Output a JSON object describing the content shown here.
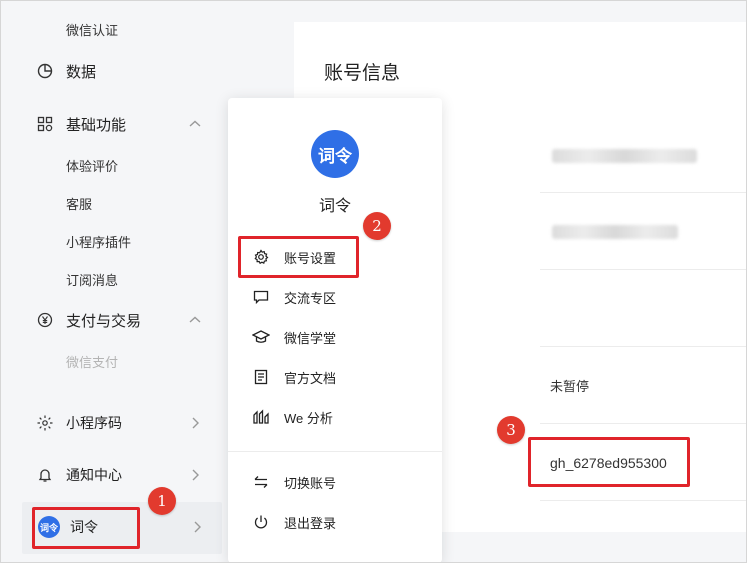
{
  "sidebar": {
    "top_sub": "微信认证",
    "data_label": "数据",
    "basic_label": "基础功能",
    "basic_subs": [
      "体验评价",
      "客服",
      "小程序插件",
      "订阅消息"
    ],
    "pay_label": "支付与交易",
    "pay_sub": "微信支付",
    "qrcode_label": "小程序码",
    "notify_label": "通知中心",
    "account_label": "词令",
    "avatar_text": "词令"
  },
  "main": {
    "title": "账号信息",
    "status_value": "未暂停",
    "original_id": "gh_6278ed955300"
  },
  "popup": {
    "avatar_text": "词令",
    "name": "词令",
    "items": [
      "账号设置",
      "交流专区",
      "微信学堂",
      "官方文档",
      "We 分析"
    ],
    "bottom_items": [
      "切换账号",
      "退出登录"
    ]
  },
  "annotations": {
    "badges": [
      "1",
      "2",
      "3"
    ],
    "highlight_color": "#e0242a"
  }
}
